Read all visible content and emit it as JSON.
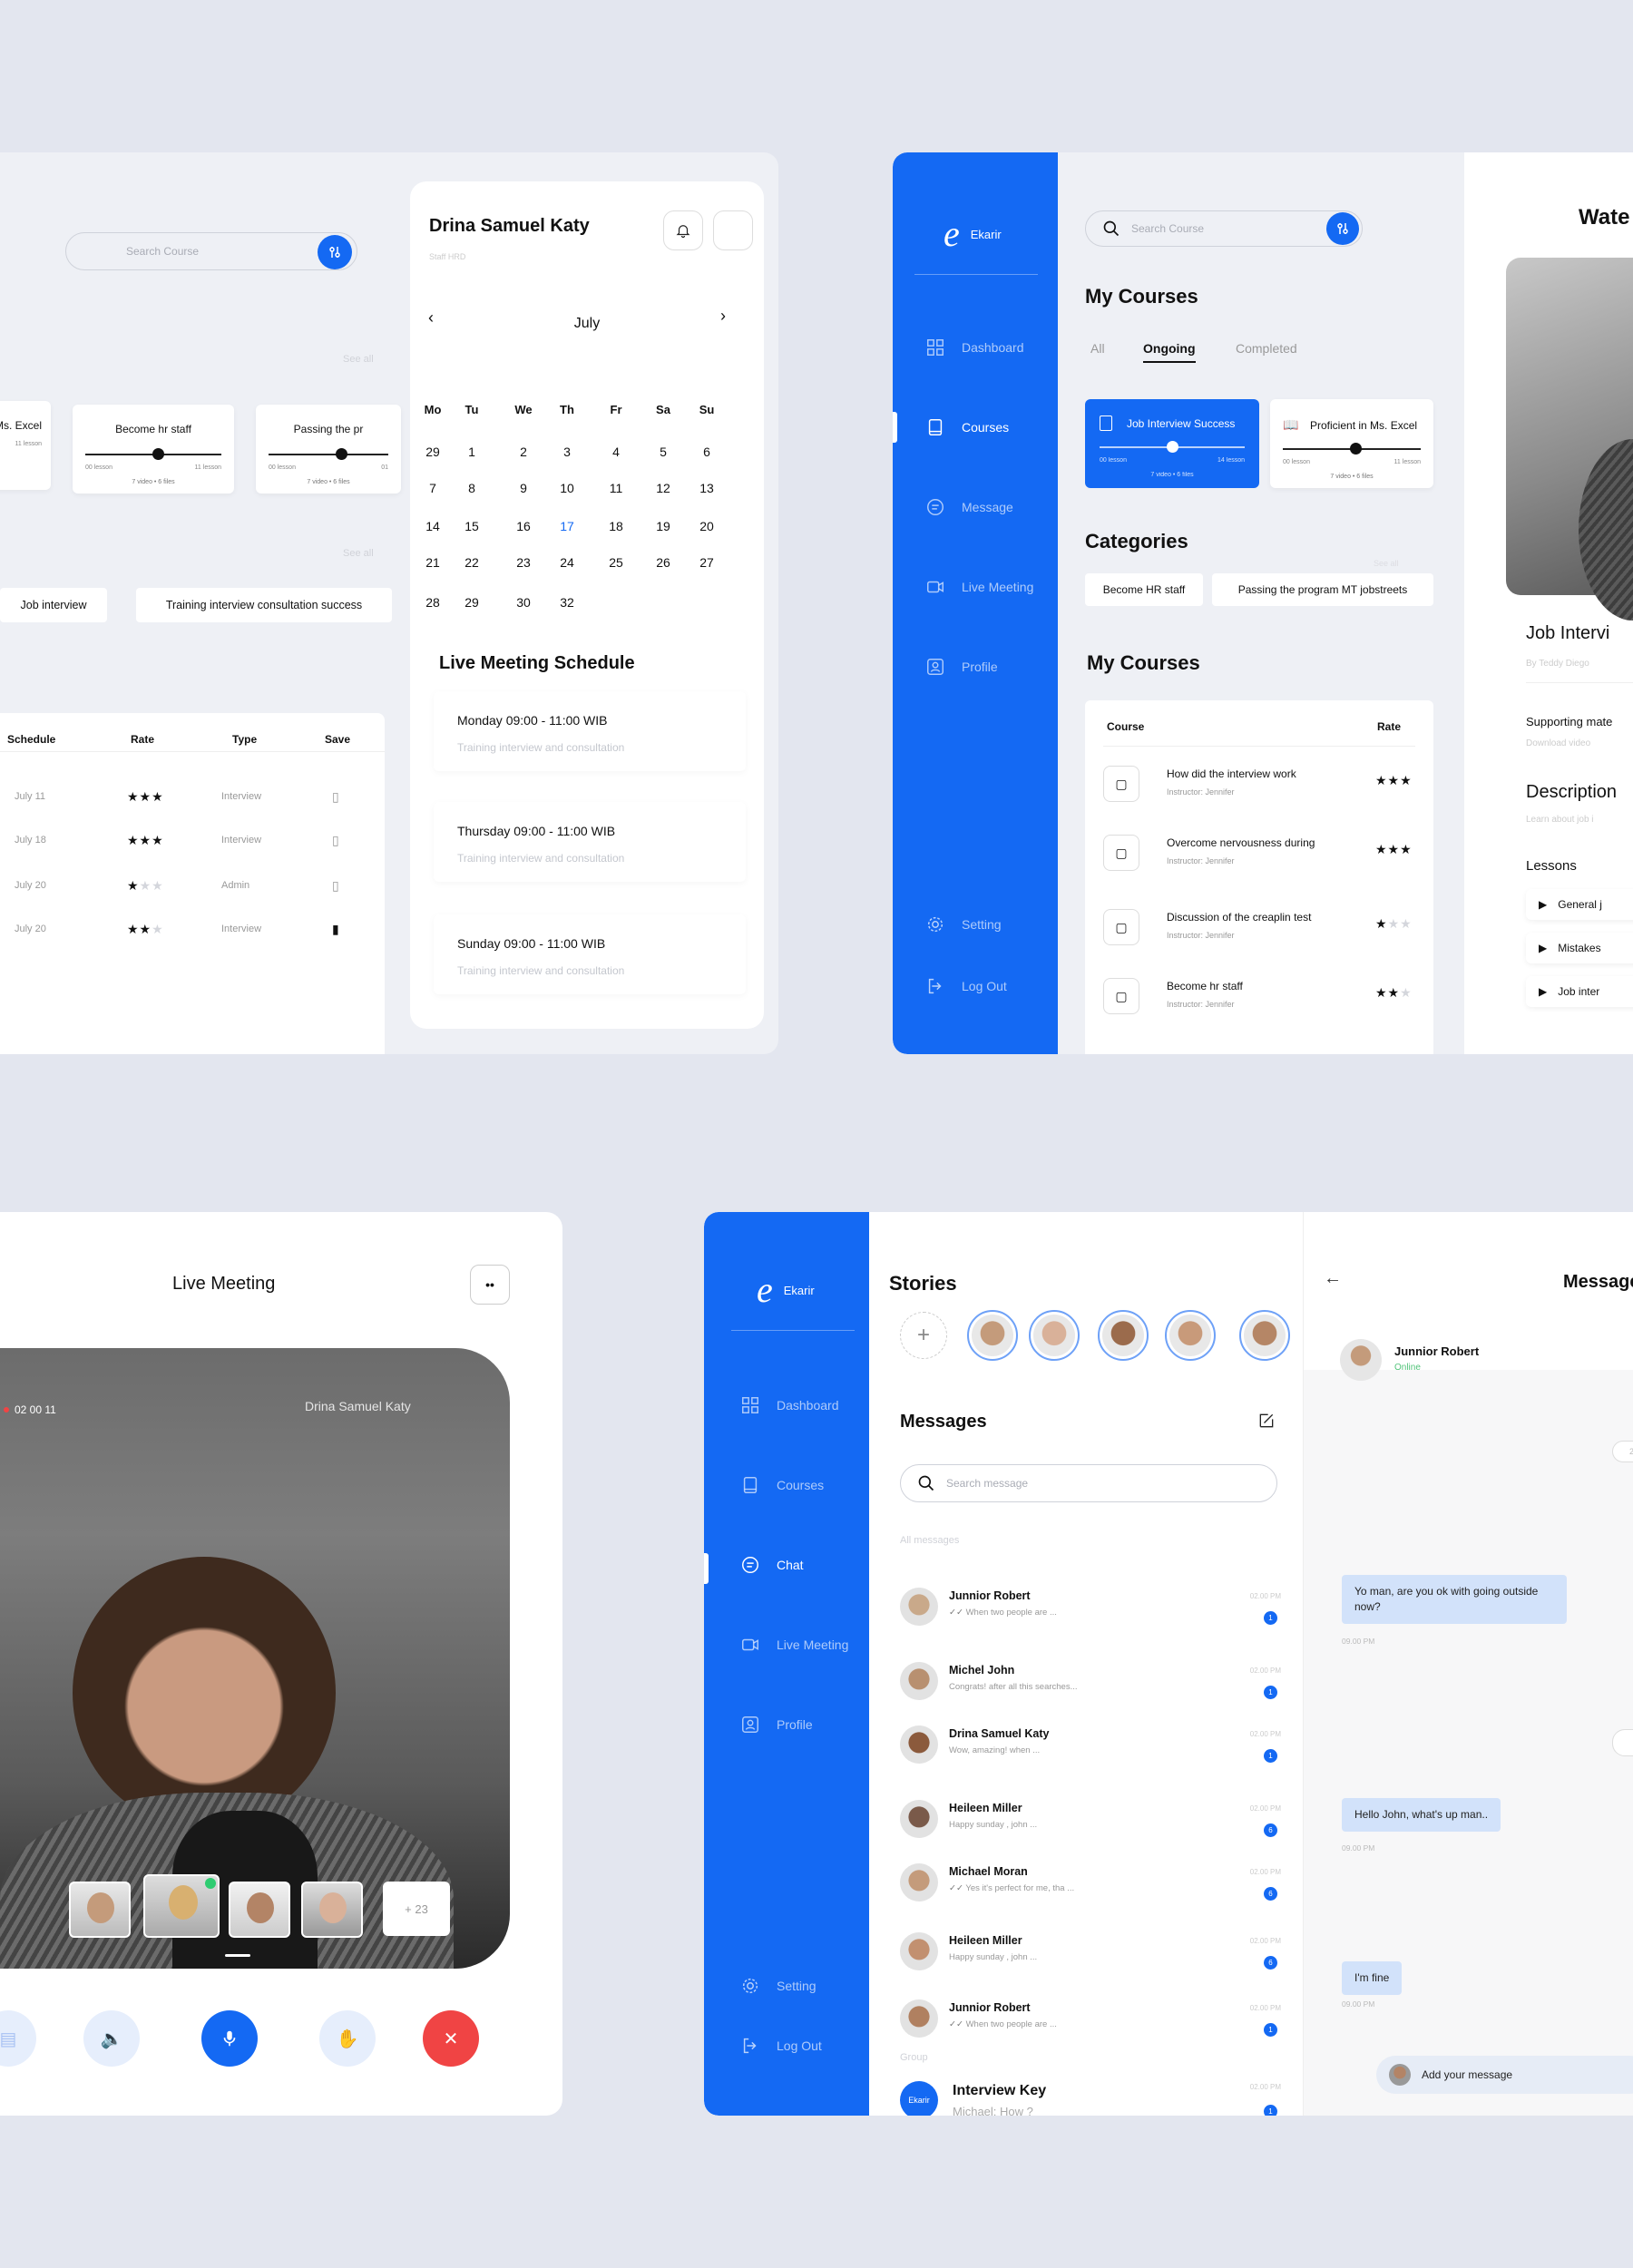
{
  "p1": {
    "search_placeholder": "Search Course",
    "see_all_1": "See all",
    "see_all_2": "See all",
    "progress_cards": [
      {
        "title": "Ms. Excel",
        "left": "",
        "right": "11 lesson",
        "bottom": "",
        "progress": 0
      },
      {
        "title": "Become hr staff",
        "left": "00 lesson",
        "right": "11 lesson",
        "bottom": "7 video  •  6 files",
        "progress": 0.45
      },
      {
        "title": "Passing the pr",
        "left": "00 lesson",
        "right": "01",
        "bottom": "7 video  •  6 files",
        "progress": 0.6
      }
    ],
    "chips": [
      "Job interview",
      "Training interview consultation success"
    ],
    "table": {
      "headers": {
        "schedule": "Schedule",
        "rate": "Rate",
        "type": "Type",
        "save": "Save"
      },
      "rows": [
        {
          "date": "July 11",
          "rating": 3,
          "type": "Interview",
          "saved": false
        },
        {
          "date": "July 18",
          "rating": 3,
          "type": "Interview",
          "saved": false
        },
        {
          "date": "July 20",
          "rating": 1,
          "type": "Admin",
          "saved": false
        },
        {
          "date": "July 20",
          "rating": 2,
          "type": "Interview",
          "saved": true
        }
      ]
    },
    "profile": {
      "name": "Drina Samuel Katy",
      "role": "Staff HRD"
    },
    "calendar": {
      "month": "July",
      "weekdays": [
        "Mo",
        "Tu",
        "We",
        "Th",
        "Fr",
        "Sa",
        "Su"
      ],
      "weeks": [
        [
          "29",
          "1",
          "2",
          "3",
          "4",
          "5",
          "6"
        ],
        [
          "7",
          "8",
          "9",
          "10",
          "11",
          "12",
          "13"
        ],
        [
          "14",
          "15",
          "16",
          "17",
          "18",
          "19",
          "20"
        ],
        [
          "21",
          "22",
          "23",
          "24",
          "25",
          "26",
          "27"
        ],
        [
          "28",
          "29",
          "30",
          "32",
          "",
          "",
          ""
        ]
      ],
      "highlight": "17",
      "highlight_color": "#1469f3"
    },
    "schedule_title": "Live Meeting Schedule",
    "schedules": [
      {
        "time": "Monday 09:00 - 11:00 WIB",
        "desc": "Training interview and consultation"
      },
      {
        "time": "Thursday 09:00 - 11:00 WIB",
        "desc": "Training interview and consultation"
      },
      {
        "time": "Sunday 09:00 - 11:00 WIB",
        "desc": "Training interview and consultation"
      }
    ]
  },
  "p2": {
    "brand": "Ekarir",
    "nav": [
      {
        "label": "Dashboard",
        "icon": "grid-icon",
        "active": false
      },
      {
        "label": "Courses",
        "icon": "book-icon",
        "active": true
      },
      {
        "label": "Message",
        "icon": "message-icon",
        "active": false
      },
      {
        "label": "Live Meeting",
        "icon": "video-icon",
        "active": false
      },
      {
        "label": "Profile",
        "icon": "profile-icon",
        "active": false
      }
    ],
    "setting": "Setting",
    "logout": "Log Out",
    "search_placeholder": "Search Course",
    "title": "My Courses",
    "tabs": [
      "All",
      "Ongoing",
      "Completed"
    ],
    "active_tab": "Ongoing",
    "cards": [
      {
        "title": "Job Interview Success",
        "left": "00 lesson",
        "right": "14 lesson",
        "bottom": "7 video  •  6 files",
        "progress": 0.5
      },
      {
        "title": "Proficient in Ms. Excel",
        "left": "00 lesson",
        "right": "11 lesson",
        "bottom": "7 video  •  6 files",
        "progress": 0.45
      }
    ],
    "categories_title": "Categories",
    "see_all": "See all",
    "categories": [
      "Become HR staff",
      "Passing the program MT jobstreets"
    ],
    "table_title": "My Courses",
    "table_headers": {
      "course": "Course",
      "rate": "Rate"
    },
    "courses": [
      {
        "title": "How did the interview work",
        "instructor": "Instructor: Jennifer",
        "rating": 3,
        "icon": "cube-icon"
      },
      {
        "title": "Overcome nervousness during",
        "instructor": "Instructor: Jennifer",
        "rating": 3,
        "icon": "clipboard-icon"
      },
      {
        "title": "Discussion of the creaplin test",
        "instructor": "Instructor: Jennifer",
        "rating": 1,
        "icon": "building-icon"
      },
      {
        "title": "Become hr staff",
        "instructor": "Instructor: Jennifer",
        "rating": 2,
        "icon": "open-book-icon"
      }
    ],
    "watch_title": "Wate",
    "course_title": "Job Intervi",
    "author": "By Teddy Diego",
    "supporting": "Supporting mate",
    "download": "Download video",
    "desc_title": "Description",
    "desc_text": "Learn about job i",
    "lessons_title": "Lessons",
    "lessons": [
      "General j",
      "Mistakes",
      "Job inter"
    ]
  },
  "p3": {
    "title": "Live Meeting",
    "rec_time": "02 00 11",
    "speaker": "Drina Samuel Katy",
    "extra_participants": "+ 23",
    "accent": "#1469f3",
    "end_color": "#f04444"
  },
  "p4": {
    "brand": "Ekarir",
    "nav": [
      {
        "label": "Dashboard",
        "icon": "grid-icon",
        "active": false
      },
      {
        "label": "Courses",
        "icon": "book-icon",
        "active": false
      },
      {
        "label": "Chat",
        "icon": "chat-icon",
        "active": true
      },
      {
        "label": "Live Meeting",
        "icon": "video-icon",
        "active": false
      },
      {
        "label": "Profile",
        "icon": "profile-icon",
        "active": false
      }
    ],
    "setting": "Setting",
    "logout": "Log Out",
    "stories_title": "Stories",
    "messages_title": "Messages",
    "search_placeholder": "Search message",
    "all_messages": "All messages",
    "messages": [
      {
        "name": "Junnior Robert",
        "preview": "When two people are ...",
        "time": "02.00 PM",
        "count": "1",
        "read": true
      },
      {
        "name": "Michel John",
        "preview": "Congrats! after all this searches...",
        "time": "02.00 PM",
        "count": "1",
        "read": false
      },
      {
        "name": "Drina Samuel  Katy",
        "preview": "Wow, amazing! when ...",
        "time": "02.00 PM",
        "count": "1",
        "read": false
      },
      {
        "name": "Heileen Miller",
        "preview": "Happy sunday , john ...",
        "time": "02.00 PM",
        "count": "6",
        "read": false
      },
      {
        "name": "Michael Moran",
        "preview": "Yes it's perfect for me, tha ...",
        "time": "02.00 PM",
        "count": "6",
        "read": true
      },
      {
        "name": "Heileen Miller",
        "preview": "Happy sunday , john ...",
        "time": "02.00 PM",
        "count": "6",
        "read": false
      },
      {
        "name": "Junnior Robert",
        "preview": "When two people are ...",
        "time": "02.00 PM",
        "count": "1",
        "read": true
      }
    ],
    "group_label": "Group",
    "group": {
      "name": "Interview Key",
      "preview": "Michael: How ?",
      "time": "02.00 PM",
      "count": "1",
      "avatar_text": "Ekarir"
    },
    "chat_title": "Message",
    "contact": {
      "name": "Junnior Robert",
      "status": "Online"
    },
    "date_pill": "2",
    "bubbles": [
      {
        "text": "Yo man, are you ok with going outside now?",
        "time": "09.00 PM"
      },
      {
        "text": "Hello John, what's up man..",
        "time": "09.00 PM"
      },
      {
        "text": "I'm fine",
        "time": "09.00 PM"
      }
    ],
    "input_placeholder": "Add your message"
  }
}
